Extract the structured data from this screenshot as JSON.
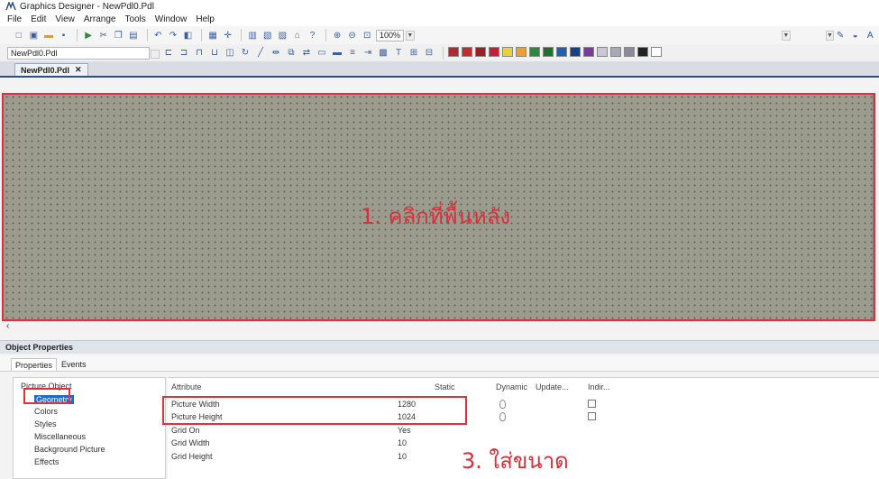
{
  "window": {
    "title": "Graphics Designer - NewPdl0.Pdl"
  },
  "menu": [
    "File",
    "Edit",
    "View",
    "Arrange",
    "Tools",
    "Window",
    "Help"
  ],
  "toolbar": {
    "zoom": "100%"
  },
  "picture_selector": {
    "value": "NewPdl0.Pdl"
  },
  "palette": [
    "#b02a32",
    "#c42b2b",
    "#9c2020",
    "#c41e3a",
    "#e8d23a",
    "#f0a02a",
    "#2a8a3a",
    "#1f6f2e",
    "#1f5fb0",
    "#173f86",
    "#7a3aa0",
    "#c8c8d8",
    "#a8a8b8",
    "#8a8a9a",
    "#222222",
    "#ffffff"
  ],
  "document_tab": {
    "label": "NewPdl0.Pdl"
  },
  "canvas": {
    "annotation": "1. คลิกที่พื้นหลัง"
  },
  "object_properties": {
    "header": "Object Properties",
    "tabs": [
      "Properties",
      "Events"
    ],
    "tree": {
      "root": "Picture Object",
      "items": [
        "Geometry",
        "Colors",
        "Styles",
        "Miscellaneous",
        "Background Picture",
        "Effects"
      ]
    },
    "columns": [
      "Attribute",
      "Static",
      "Dynamic",
      "Update...",
      "Indir..."
    ],
    "rows": [
      {
        "attribute": "Picture Width",
        "static": "1280"
      },
      {
        "attribute": "Picture Height",
        "static": "1024"
      },
      {
        "attribute": "Grid On",
        "static": "Yes"
      },
      {
        "attribute": "Grid Width",
        "static": "10"
      },
      {
        "attribute": "Grid Height",
        "static": "10"
      }
    ],
    "annotation": "3. ใส่ขนาด"
  }
}
